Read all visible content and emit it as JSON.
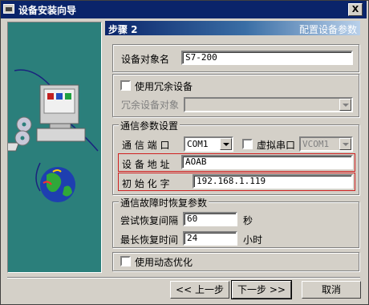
{
  "window": {
    "title": "设备安装向导",
    "close_label": "X"
  },
  "header": {
    "step": "步骤 2",
    "description": "配置设备参数"
  },
  "device_name": {
    "label": "设备对象名",
    "value": "S7-200"
  },
  "redundancy": {
    "checkbox_label": "使用冗余设备",
    "object_label": "冗余设备对象",
    "object_value": ""
  },
  "comm": {
    "group_label": "通信参数设置",
    "port_label": "通 信 端 口",
    "port_value": "COM1",
    "virtual_label": "虚拟串口",
    "virtual_value": "VCOM1",
    "address_label": "设 备 地 址",
    "address_value": "AOAB",
    "init_label": "初 始 化 字",
    "init_value": "192.168.1.119"
  },
  "recovery": {
    "group_label": "通信故障时恢复参数",
    "retry_label": "尝试恢复间隔",
    "retry_value": "60",
    "retry_unit": "秒",
    "max_label": "最长恢复时间",
    "max_value": "24",
    "max_unit": "小时"
  },
  "dynamic_opt": {
    "label": "使用动态优化"
  },
  "buttons": {
    "prev": "<< 上一步",
    "next": "下一步 >>",
    "cancel": "取消"
  }
}
